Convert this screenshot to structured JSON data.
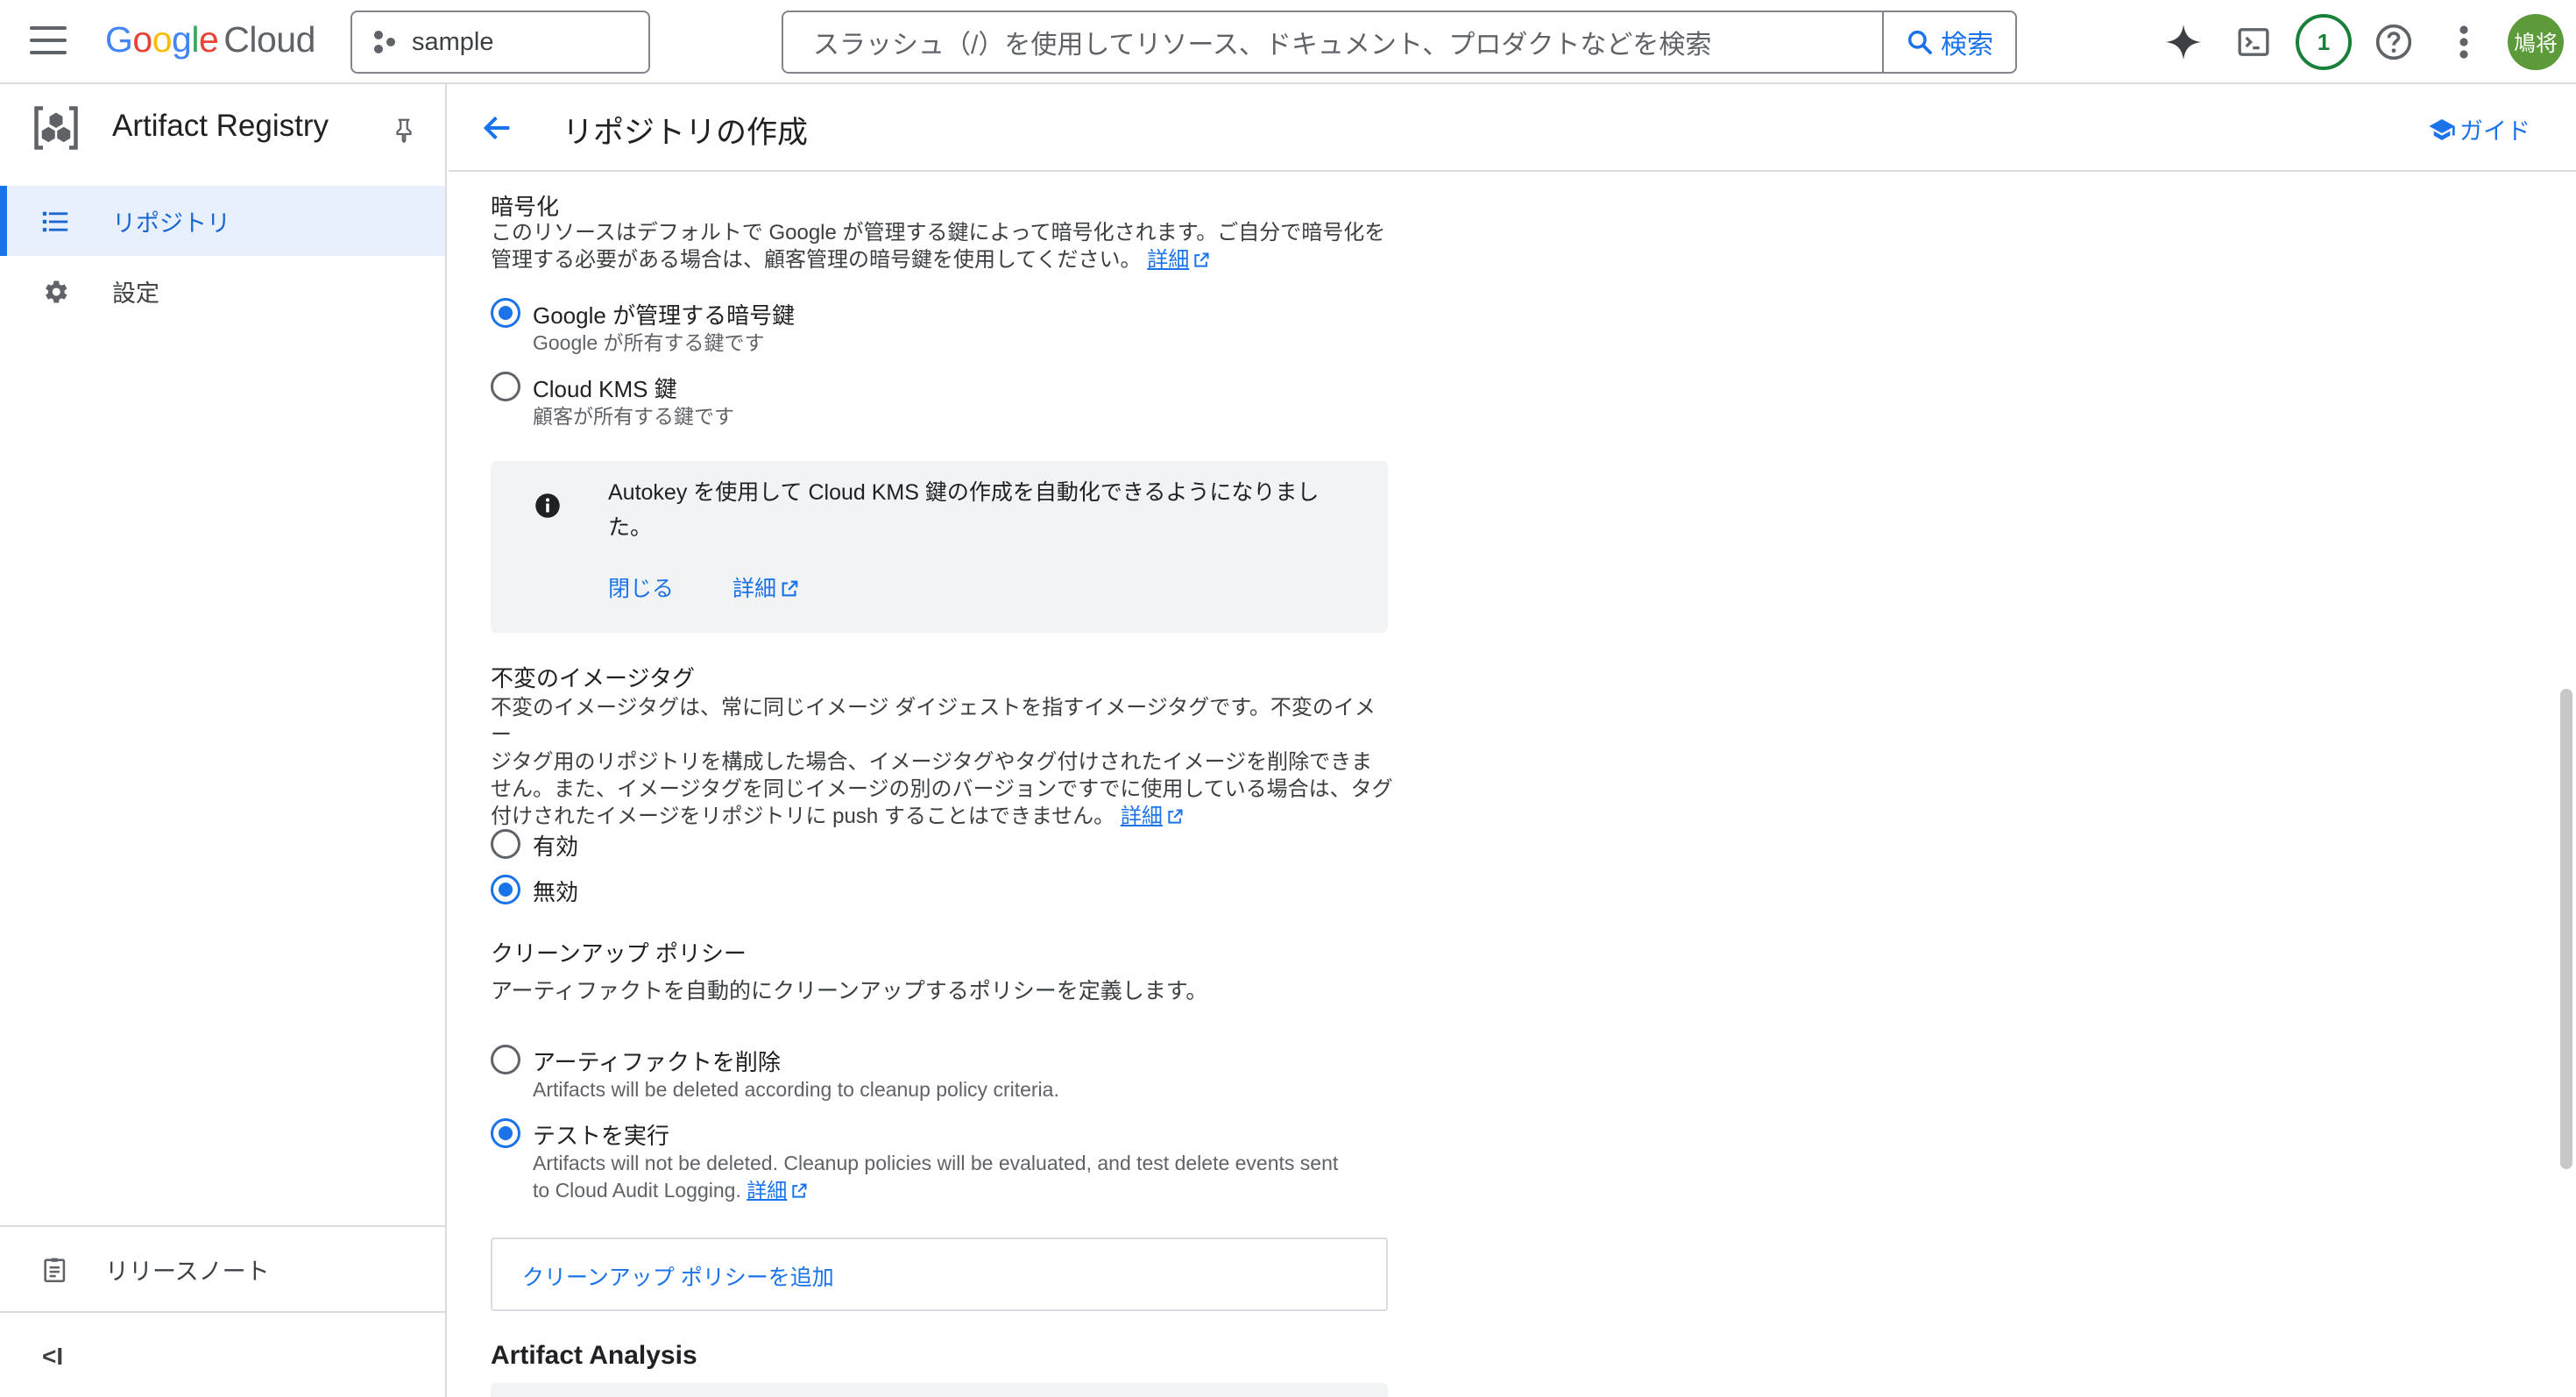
{
  "topbar": {
    "logo": {
      "G": "G",
      "o1": "o",
      "o2": "o",
      "g": "g",
      "l": "l",
      "e": "e",
      "cloud": "Cloud"
    },
    "project": "sample",
    "search_placeholder": "スラッシュ（/）を使用してリソース、ドキュメント、プロダクトなどを検索",
    "search_button": "検索",
    "notifications": "1",
    "avatar_initials": "鳩将"
  },
  "sidebar": {
    "product": "Artifact Registry",
    "items": [
      {
        "label": "リポジトリ",
        "active": true
      },
      {
        "label": "設定",
        "active": false
      }
    ],
    "release_notes": "リリースノート",
    "collapse": "<I"
  },
  "header": {
    "title": "リポジトリの作成",
    "guide": "ガイド"
  },
  "encryption": {
    "title": "暗号化",
    "desc_line1": "このリソースはデフォルトで Google が管理する鍵によって暗号化されます。ご自分で暗号化を",
    "desc_line2": "管理する必要がある場合は、顧客管理の暗号鍵を使用してください。",
    "learn_more": "詳細",
    "options": [
      {
        "label": "Google が管理する暗号鍵",
        "sub": "Google が所有する鍵です",
        "selected": true
      },
      {
        "label": "Cloud KMS 鍵",
        "sub": "顧客が所有する鍵です",
        "selected": false
      }
    ],
    "info": {
      "line1": "Autokey を使用して Cloud KMS 鍵の作成を自動化できるようになりまし",
      "line2": "た。",
      "close": "閉じる",
      "learn_more": "詳細"
    }
  },
  "immutable_tags": {
    "title": "不変のイメージタグ",
    "desc_line1": "不変のイメージタグは、常に同じイメージ ダイジェストを指すイメージタグです。不変のイメー",
    "desc_line2": "ジタグ用のリポジトリを構成した場合、イメージタグやタグ付けされたイメージを削除できま",
    "desc_line3": "せん。また、イメージタグを同じイメージの別のバージョンですでに使用している場合は、タグ",
    "desc_line4": "付けされたイメージをリポジトリに push することはできません。",
    "learn_more": "詳細",
    "options": [
      {
        "label": "有効",
        "selected": false
      },
      {
        "label": "無効",
        "selected": true
      }
    ]
  },
  "cleanup": {
    "title": "クリーンアップ ポリシー",
    "desc": "アーティファクトを自動的にクリーンアップするポリシーを定義します。",
    "options": [
      {
        "label": "アーティファクトを削除",
        "sub": "Artifacts will be deleted according to cleanup policy criteria.",
        "selected": false
      },
      {
        "label": "テストを実行",
        "sub_line1": "Artifacts will not be deleted. Cleanup policies will be evaluated, and test delete events sent",
        "sub_line2": "to Cloud Audit Logging.",
        "learn_more": "詳細",
        "selected": true
      }
    ],
    "add_button": "クリーンアップ ポリシーを追加"
  },
  "artifact_analysis": {
    "title": "Artifact Analysis"
  },
  "colors": {
    "accent": "#1a73e8",
    "notif_ring": "#188038",
    "avatar_bg": "#5c9a3a",
    "info_bg": "#f1f3f4"
  }
}
